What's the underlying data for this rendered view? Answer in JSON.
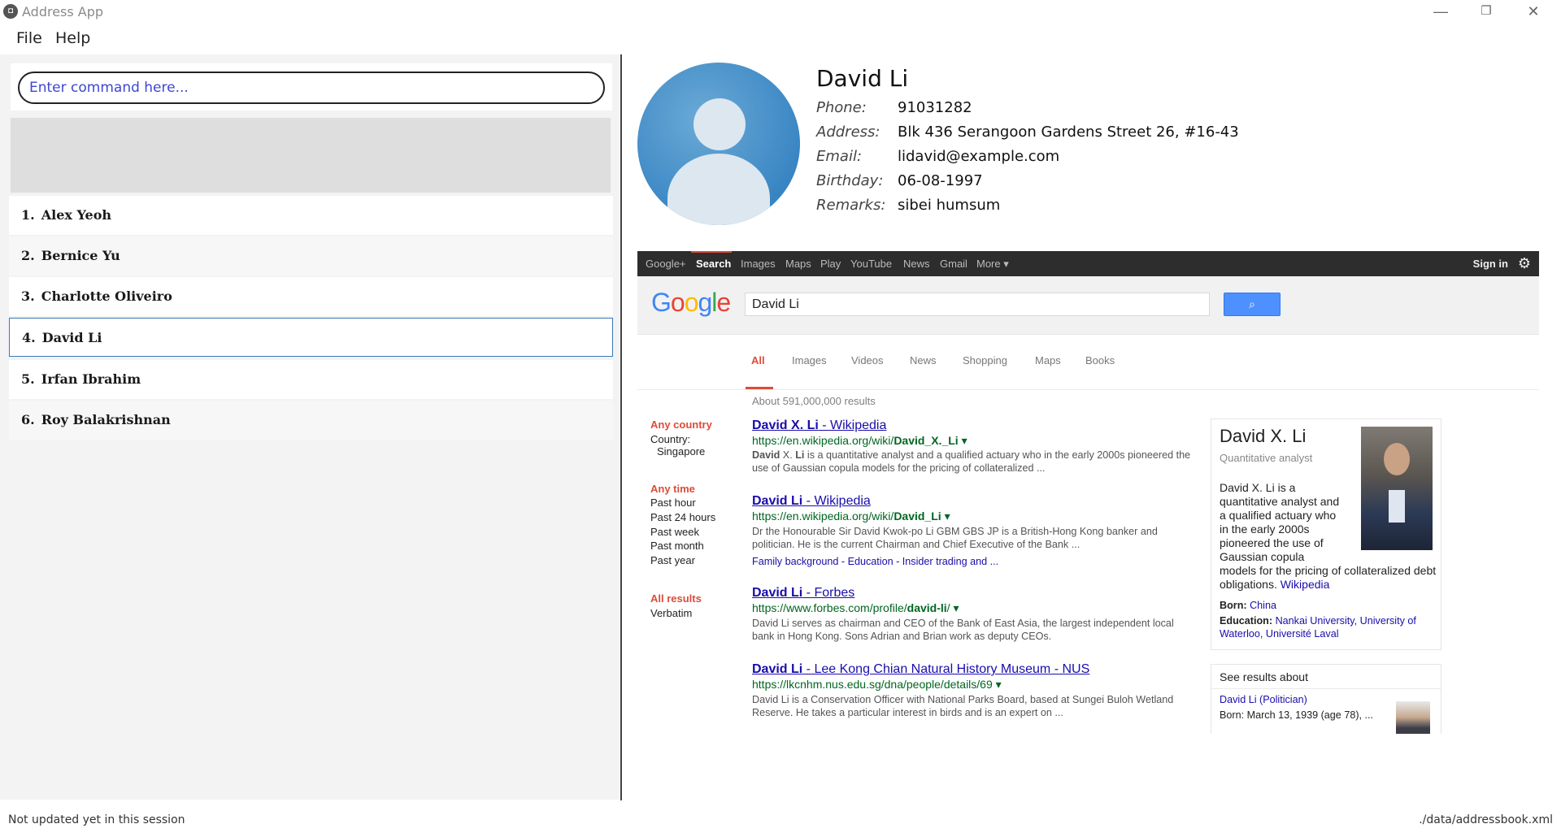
{
  "window": {
    "title": "Address App",
    "app_icon_glyph": "◘",
    "minimize_glyph": "—",
    "restore_glyph": "❐",
    "close_glyph": "✕"
  },
  "menu": {
    "file": "File",
    "help": "Help"
  },
  "command": {
    "placeholder": "Enter command here..."
  },
  "persons": [
    {
      "index": "1.",
      "name": "Alex Yeoh"
    },
    {
      "index": "2.",
      "name": "Bernice Yu"
    },
    {
      "index": "3.",
      "name": "Charlotte Oliveiro"
    },
    {
      "index": "4.",
      "name": "David Li"
    },
    {
      "index": "5.",
      "name": "Irfan Ibrahim"
    },
    {
      "index": "6.",
      "name": "Roy Balakrishnan"
    }
  ],
  "selected_person_index": 3,
  "detail": {
    "name": "David Li",
    "phone_label": "Phone:",
    "phone": "91031282",
    "address_label": "Address:",
    "address": "Blk 436 Serangoon Gardens Street 26, #16-43",
    "email_label": "Email:",
    "email": "lidavid@example.com",
    "birthday_label": "Birthday:",
    "birthday": "06-08-1997",
    "remarks_label": "Remarks:",
    "remarks": "sibei humsum"
  },
  "browser": {
    "gbar": {
      "items": [
        "Google+",
        "Search",
        "Images",
        "Maps",
        "Play",
        "YouTube",
        "News",
        "Gmail",
        "More ▾"
      ],
      "sign_in": "Sign in",
      "gear_glyph": "⚙"
    },
    "logo": [
      "G",
      "o",
      "o",
      "g",
      "l",
      "e"
    ],
    "logo_colors": [
      "#4285F4",
      "#EA4335",
      "#FBBC05",
      "#4285F4",
      "#34A853",
      "#EA4335"
    ],
    "search_query": "David Li",
    "search_button_glyph": "⌕",
    "tabs": [
      "All",
      "Images",
      "Videos",
      "News",
      "Shopping",
      "Maps",
      "Books"
    ],
    "stats": "About 591,000,000 results",
    "tools": {
      "country_head": "Any country",
      "country_label": "Country:",
      "country_value": "Singapore",
      "time_head": "Any time",
      "time_items": [
        "Past hour",
        "Past 24 hours",
        "Past week",
        "Past month",
        "Past year"
      ],
      "results_head": "All results",
      "results_item": "Verbatim"
    },
    "results": [
      {
        "title_bold": "David X. Li",
        "title_rest": " - Wikipedia",
        "url_plain": "https://en.wikipedia.org/wiki/",
        "url_bold": "David_X._Li",
        "snippet_bold": "David",
        "snippet_mid": " X. ",
        "snippet_bold2": "Li",
        "snippet_rest": " is a quantitative analyst and a qualified actuary who in the early 2000s pioneered the use of Gaussian copula models for the pricing of collateralized ..."
      },
      {
        "title_bold": "David Li",
        "title_rest": " - Wikipedia",
        "url_plain": "https://en.wikipedia.org/wiki/",
        "url_bold": "David_Li",
        "snippet_text": "Dr the Honourable Sir David Kwok-po Li GBM GBS JP is a British-Hong Kong banker and politician. He is the current Chairman and Chief Executive of the Bank ...",
        "links": "Family background - Education - Insider trading and ..."
      },
      {
        "title_bold": "David Li",
        "title_rest": " - Forbes",
        "url_plain": "https://www.forbes.com/profile/",
        "url_bold": "david-li",
        "url_tail": "/",
        "snippet_text": "David Li serves as chairman and CEO of the Bank of East Asia, the largest independent local bank in Hong Kong. Sons Adrian and Brian work as deputy CEOs."
      },
      {
        "title_bold": "David Li",
        "title_rest": " - Lee Kong Chian Natural History Museum - NUS",
        "url_plain": "https://lkcnhm.nus.edu.sg/dna/people/details/69",
        "snippet_text": "David Li is a Conservation Officer with National Parks Board, based at Sungei Buloh Wetland Reserve. He takes a particular interest in birds and is an expert on  ..."
      }
    ],
    "knowledge_panel": {
      "name": "David X. Li",
      "subtitle": "Quantitative analyst",
      "desc_lines": [
        "David X. Li is a",
        "quantitative analyst and",
        "a qualified actuary who",
        "in the early 2000s",
        "pioneered the use of",
        "Gaussian copula"
      ],
      "desc_tail": "models for the pricing of collateralized debt obligations.",
      "desc_link": "Wikipedia",
      "born_label": "Born:",
      "born_value": "China",
      "edu_label": "Education:",
      "edu_value": "Nankai University, University of Waterloo, Université Laval"
    },
    "see_results": {
      "title": "See results about",
      "link": "David Li (Politician)",
      "born": "Born: March 13, 1939 (age 78), ..."
    }
  },
  "status": {
    "left": "Not updated yet in this session",
    "right": "./data/addressbook.xml"
  }
}
